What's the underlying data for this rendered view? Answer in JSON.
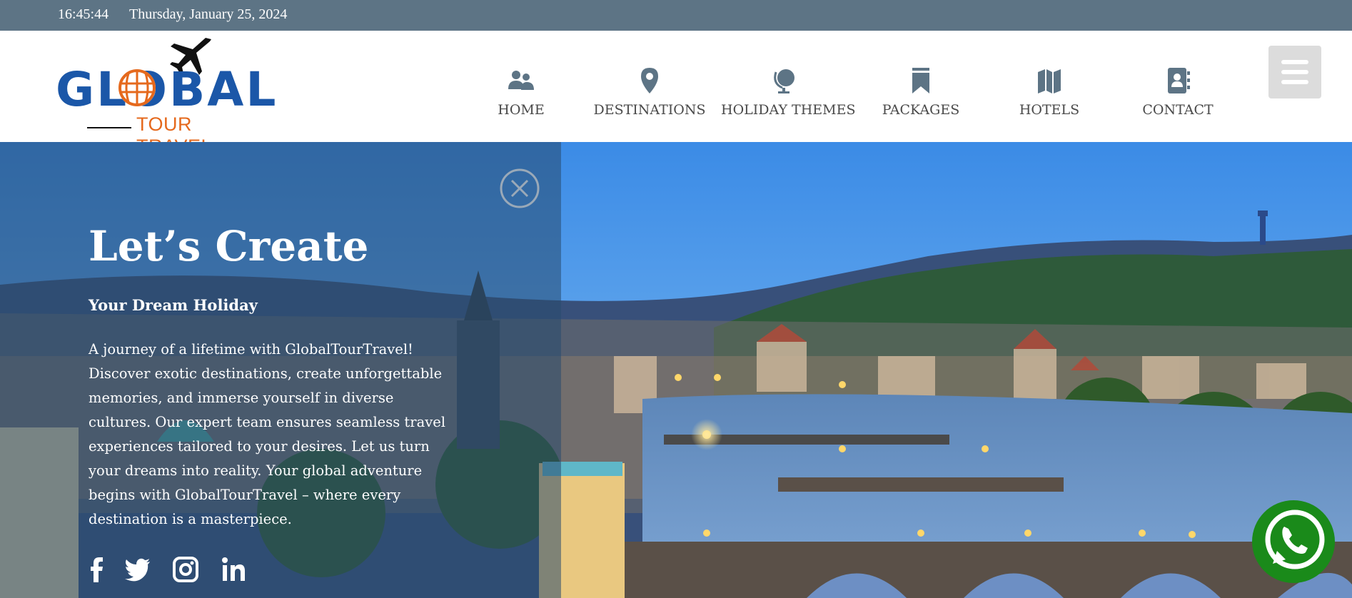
{
  "topbar": {
    "time": "16:45:44",
    "date": "Thursday, January 25, 2024"
  },
  "logo": {
    "word": "GLOBAL",
    "subtitle": "TOUR TRAVEL"
  },
  "nav": {
    "items": [
      {
        "label": "HOME",
        "icon": "users-icon"
      },
      {
        "label": "DESTINATIONS",
        "icon": "map-pin-icon"
      },
      {
        "label": "HOLIDAY THEMES",
        "icon": "globe-icon"
      },
      {
        "label": "PACKAGES",
        "icon": "bookmark-icon"
      },
      {
        "label": "HOTELS",
        "icon": "map-icon"
      },
      {
        "label": "CONTACT",
        "icon": "address-book-icon"
      }
    ],
    "menu_icon": "hamburger-menu-icon"
  },
  "hero": {
    "title": "Let’s Create",
    "subtitle": "Your Dream Holiday",
    "text": "A journey of a lifetime with GlobalTourTravel! Discover exotic destinations, create unforgettable memories, and immerse yourself in diverse cultures. Our expert team ensures seamless travel experiences tailored to your desires. Let us turn your dreams into reality. Your global adventure begins with GlobalTourTravel – where every destination is a masterpiece.",
    "close_icon": "close-circle-icon",
    "social": [
      "facebook-icon",
      "twitter-icon",
      "instagram-icon",
      "linkedin-icon"
    ]
  },
  "whatsapp": {
    "icon": "whatsapp-icon"
  },
  "colors": {
    "topbar": "#5d7485",
    "nav_icon": "#5d7485",
    "nav_text": "#4a4a4a",
    "logo_blue": "#1b57a8",
    "logo_orange": "#e5691d",
    "panel": "#284b6e",
    "whatsapp": "#1a8a1a"
  }
}
